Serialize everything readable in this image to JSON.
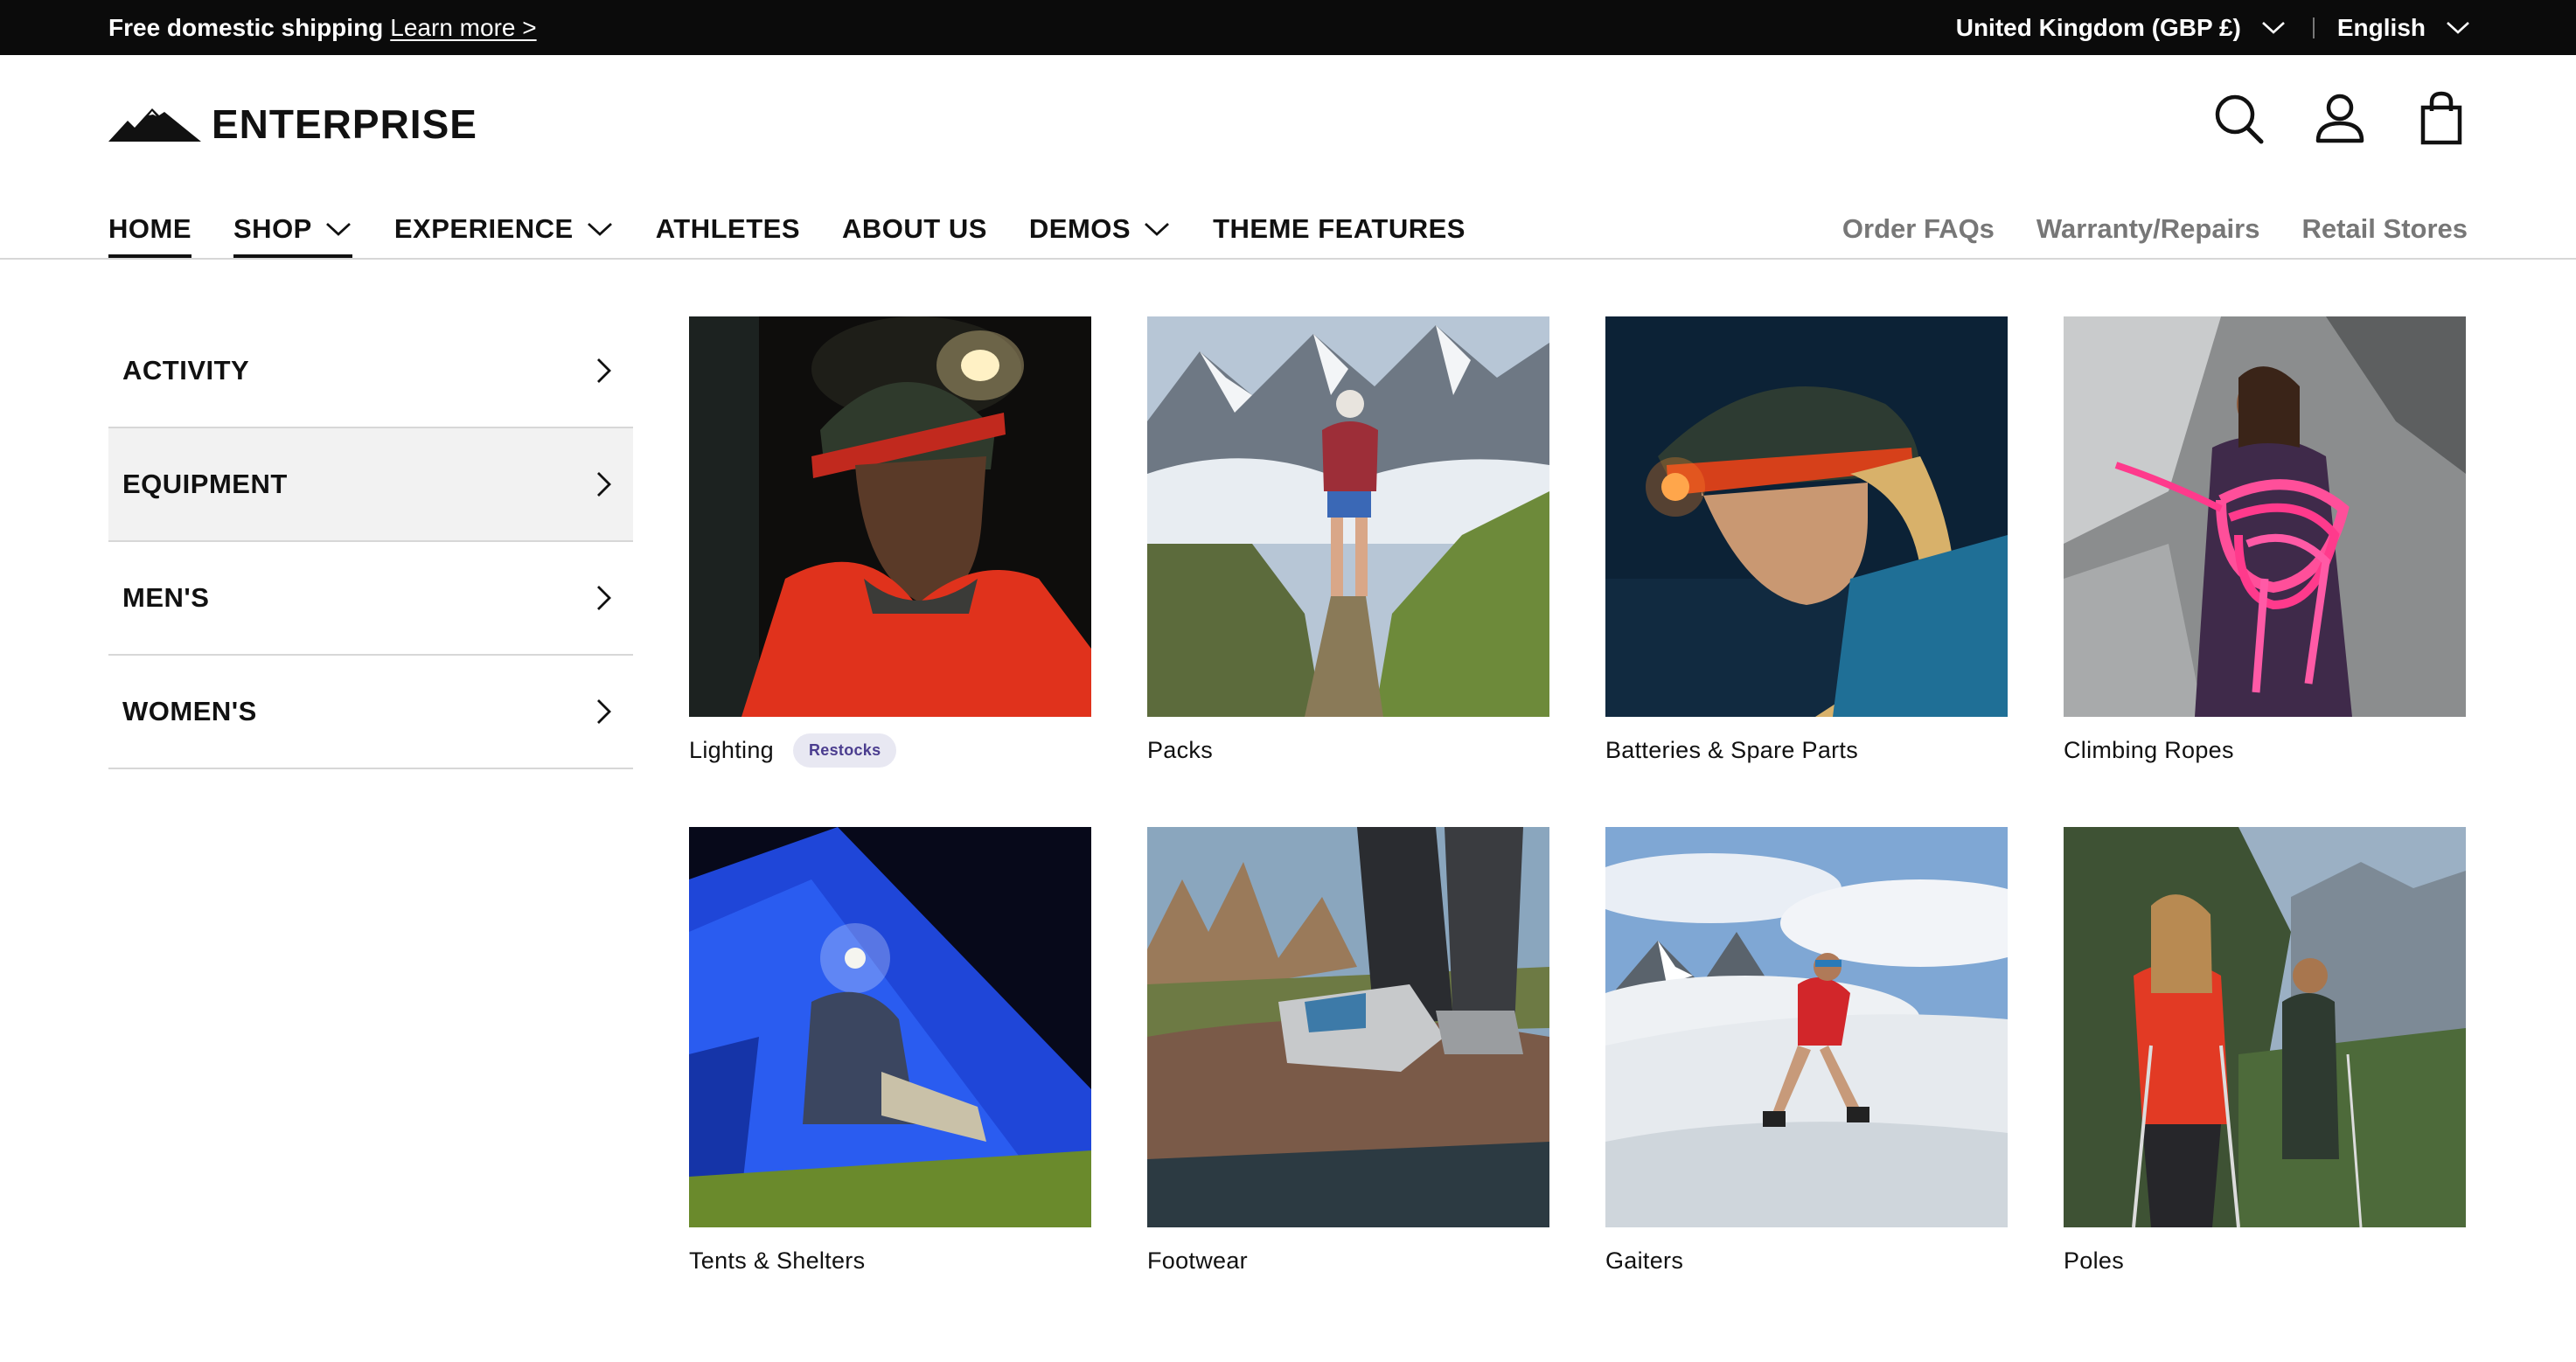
{
  "announcement": {
    "text": "Free domestic shipping",
    "link": "Learn more >",
    "country": "United Kingdom (GBP £)",
    "language": "English"
  },
  "brand": {
    "name": "ENTERPRISE",
    "icon": "mountain-logo-icon"
  },
  "header_icons": [
    "search-icon",
    "account-icon",
    "cart-bag-icon"
  ],
  "nav": {
    "items": [
      {
        "label": "HOME",
        "active": true,
        "dropdown": false
      },
      {
        "label": "SHOP",
        "active": true,
        "dropdown": true
      },
      {
        "label": "EXPERIENCE",
        "dropdown": true
      },
      {
        "label": "ATHLETES",
        "dropdown": false
      },
      {
        "label": "ABOUT US",
        "dropdown": false
      },
      {
        "label": "DEMOS",
        "dropdown": true
      },
      {
        "label": "THEME FEATURES",
        "dropdown": false
      }
    ],
    "secondary": [
      "Order FAQs",
      "Warranty/Repairs",
      "Retail Stores"
    ]
  },
  "mega_menu": {
    "categories": [
      {
        "label": "ACTIVITY"
      },
      {
        "label": "EQUIPMENT",
        "selected": true
      },
      {
        "label": "MEN'S"
      },
      {
        "label": "WOMEN'S"
      }
    ],
    "products": [
      {
        "label": "Lighting",
        "badge": "Restocks"
      },
      {
        "label": "Packs"
      },
      {
        "label": "Batteries & Spare Parts"
      },
      {
        "label": "Climbing Ropes"
      },
      {
        "label": "Tents & Shelters"
      },
      {
        "label": "Footwear"
      },
      {
        "label": "Gaiters"
      },
      {
        "label": "Poles"
      }
    ]
  },
  "colors": {
    "topbar": "#0b0b0b",
    "badge_bg": "#e8e8f2",
    "badge_text": "#4b3d8f",
    "selected_row": "#f2f2f2"
  }
}
